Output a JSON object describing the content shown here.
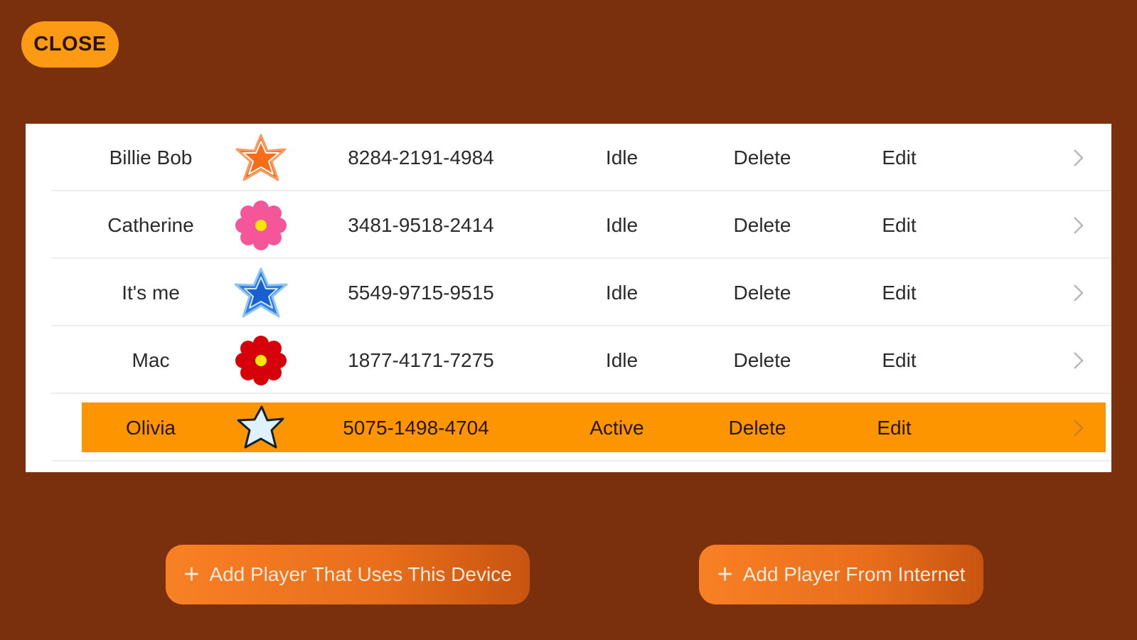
{
  "close_button": {
    "label": "CLOSE"
  },
  "players": [
    {
      "name": "Billie Bob",
      "avatar": "orange-star-icon",
      "code": "8284-2191-4984",
      "status": "Idle",
      "delete_label": "Delete",
      "edit_label": "Edit",
      "chevron": "›",
      "active": false
    },
    {
      "name": "Catherine",
      "avatar": "pink-flower-icon",
      "code": "3481-9518-2414",
      "status": "Idle",
      "delete_label": "Delete",
      "edit_label": "Edit",
      "chevron": "›",
      "active": false
    },
    {
      "name": "It's me",
      "avatar": "blue-star-icon",
      "code": "5549-9715-9515",
      "status": "Idle",
      "delete_label": "Delete",
      "edit_label": "Edit",
      "chevron": "›",
      "active": false
    },
    {
      "name": "Mac",
      "avatar": "red-flower-icon",
      "code": "1877-4171-7275",
      "status": "Idle",
      "delete_label": "Delete",
      "edit_label": "Edit",
      "chevron": "›",
      "active": false
    },
    {
      "name": "Olivia",
      "avatar": "light-blue-star-icon",
      "code": "5075-1498-4704",
      "status": "Active",
      "delete_label": "Delete",
      "edit_label": "Edit",
      "chevron": "›",
      "active": true
    }
  ],
  "actions": {
    "add_device_label": "Add Player That Uses This Device",
    "add_internet_label": "Add Player From Internet",
    "plus_glyph": "+"
  },
  "colors": {
    "background": "#7a300d",
    "accent_orange": "#fd9a14",
    "row_highlight": "#fd9500",
    "button_orange": "#f88024",
    "panel": "#ffffff"
  }
}
